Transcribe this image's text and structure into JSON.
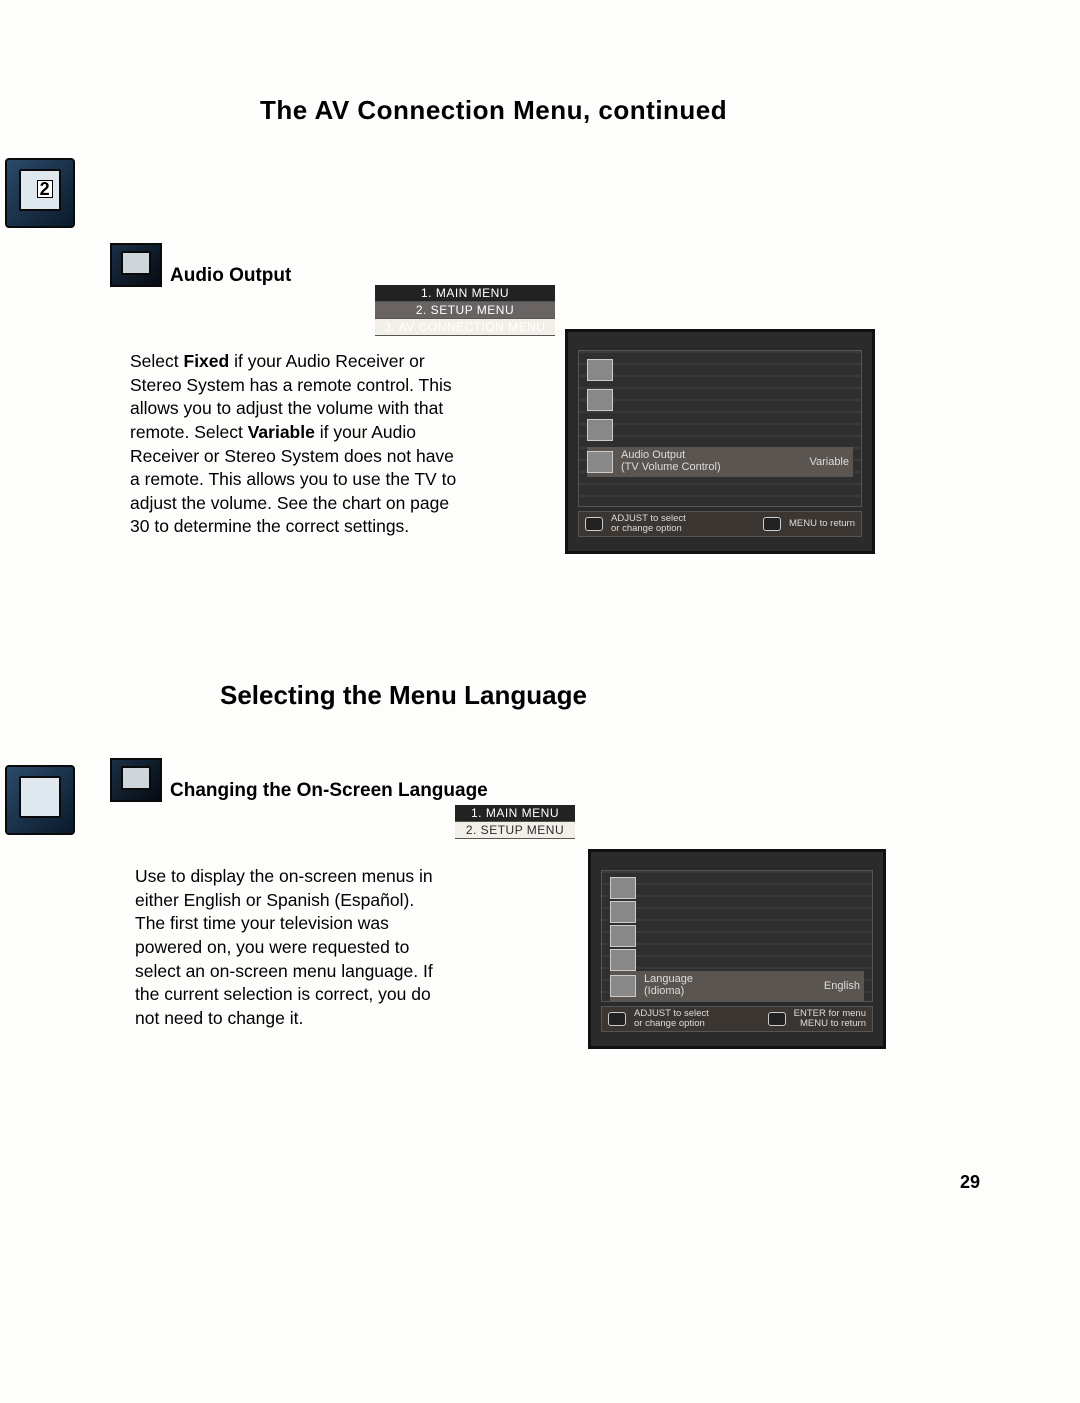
{
  "page": {
    "title1": "The AV Connection Menu, continued",
    "title2": "Selecting the Menu Language",
    "page_number": "29",
    "top_icon_label": "2"
  },
  "section1": {
    "subhead": "Audio Output",
    "breadcrumb": [
      "1. MAIN MENU",
      "2. SETUP MENU",
      "3. AV CONNECTION MENU"
    ],
    "body_parts": [
      "Select ",
      "Fixed",
      " if your Audio Receiver or Stereo System has a remote control. This allows you to adjust the volume with that remote. Select ",
      "Variable",
      " if your Audio Receiver or Stereo System does not have a remote. This allows you to use the TV to adjust the volume. See the chart on page 30 to determine the correct settings."
    ],
    "osd": {
      "highlight_label": "Audio Output\n(TV Volume Control)",
      "highlight_value": "Variable",
      "foot_left": "ADJUST to select\nor change option",
      "foot_right": "MENU to return"
    }
  },
  "section2": {
    "subhead": "Changing the On-Screen Language",
    "breadcrumb": [
      "1. MAIN MENU",
      "2. SETUP MENU"
    ],
    "body": "Use to display the on-screen menus in either English or Spanish (Español). The first time your television was powered on, you were requested to select an on-screen menu language. If the current selection is correct, you do not need to change it.",
    "osd": {
      "highlight_label": "Language\n(Idioma)",
      "highlight_value": "English",
      "foot_left": "ADJUST to select\nor change option",
      "foot_right": "ENTER for menu\nMENU to return"
    }
  }
}
